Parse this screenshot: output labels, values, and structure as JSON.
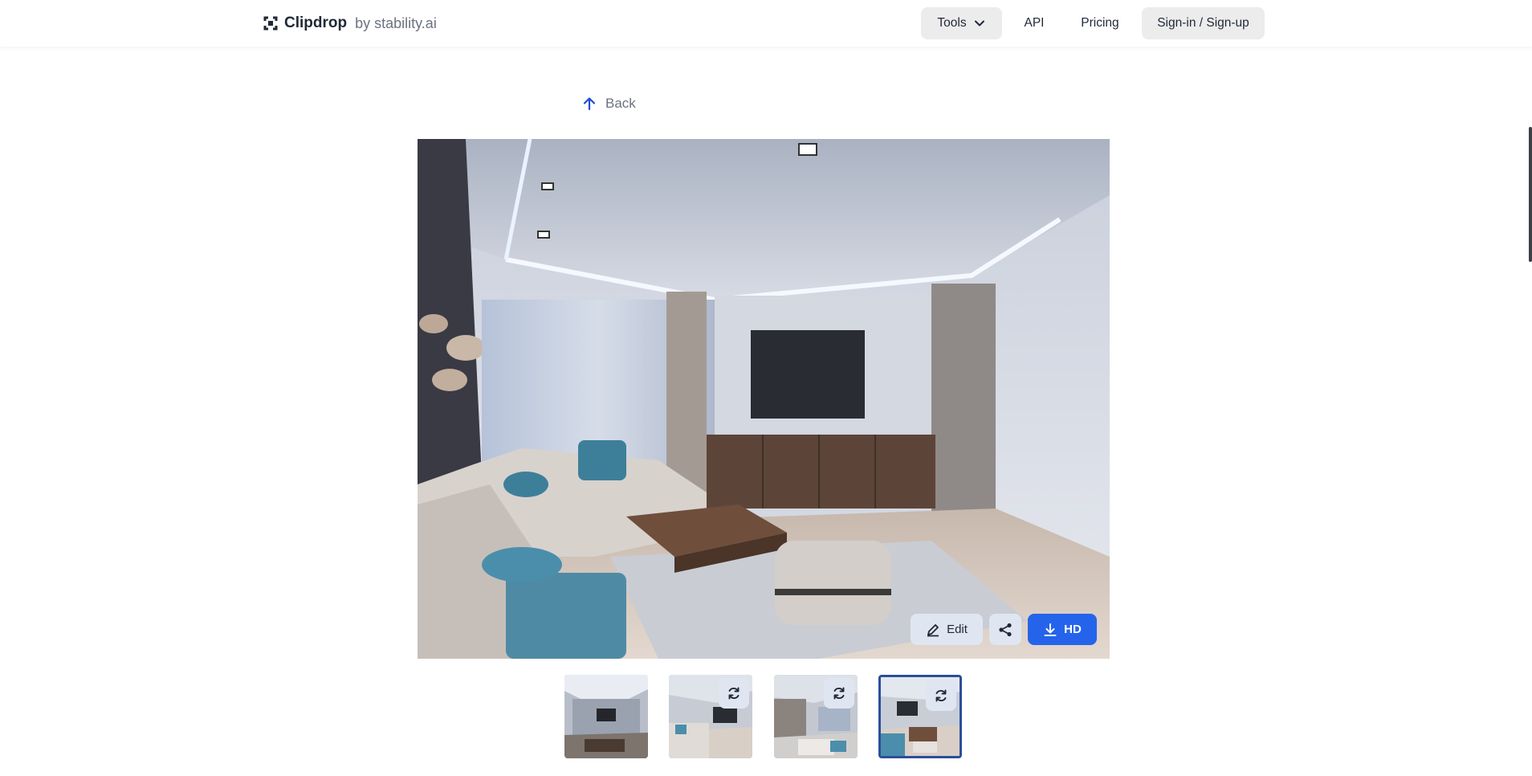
{
  "header": {
    "brand_name": "Clipdrop",
    "brand_sub": "by stability.ai",
    "nav": {
      "tools_label": "Tools",
      "api_label": "API",
      "pricing_label": "Pricing",
      "signin_label": "Sign-in / Sign-up"
    }
  },
  "back": {
    "label": "Back"
  },
  "image_actions": {
    "edit_label": "Edit",
    "hd_label": "HD"
  },
  "icons": [
    "clipdrop-logo-icon",
    "chevron-down-icon",
    "arrow-up-icon",
    "pencil-icon",
    "share-icon",
    "download-icon",
    "refresh-icon"
  ],
  "colors": {
    "accent": "#2563eb",
    "selected_border": "#2a4f9a",
    "button_bg": "#ececec"
  },
  "thumbnails": {
    "count": 4,
    "selected_index": 3
  }
}
